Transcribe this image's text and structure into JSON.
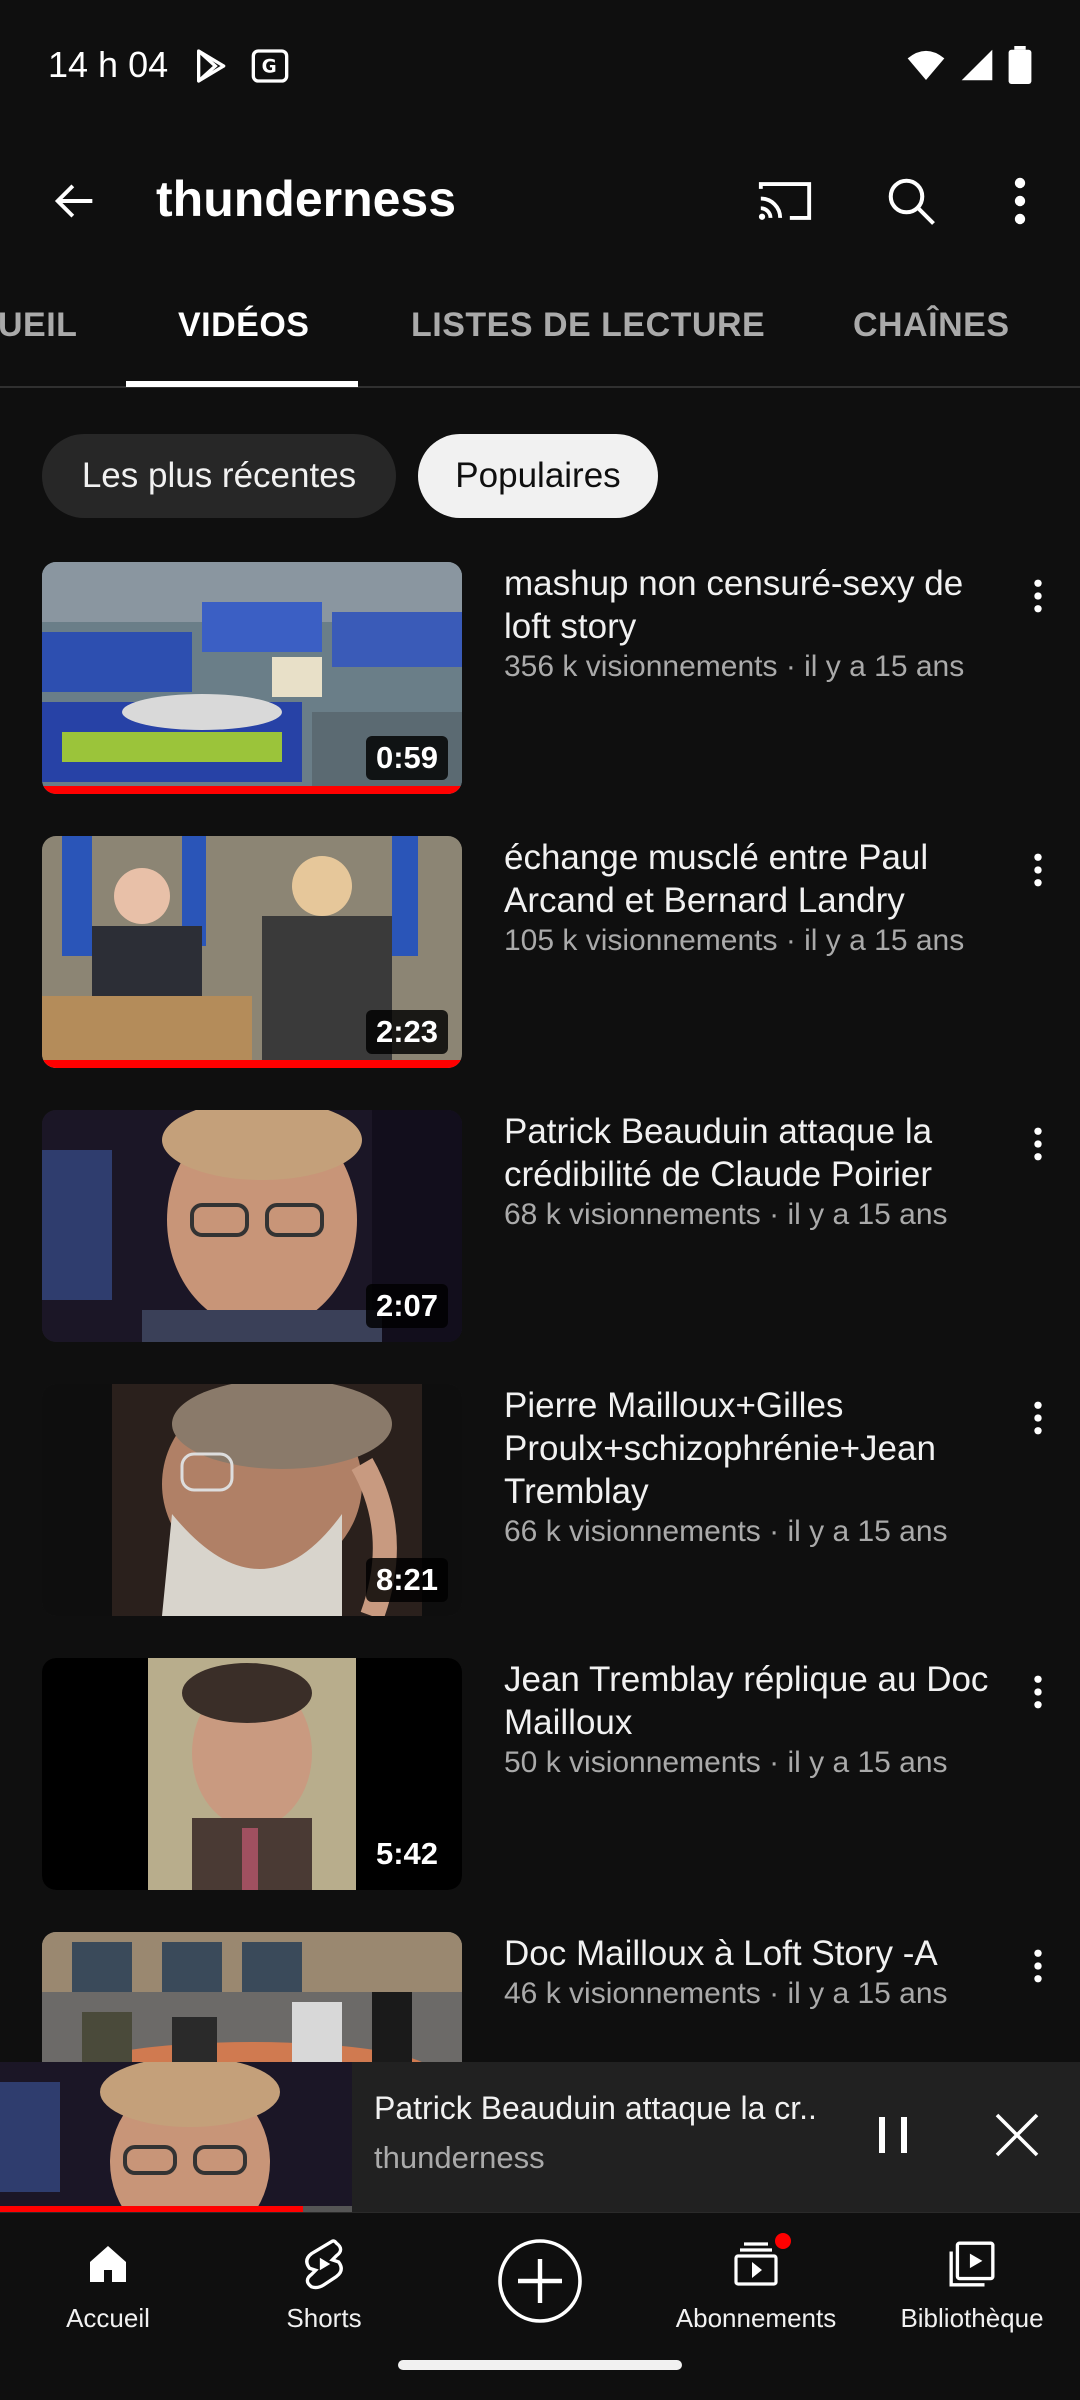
{
  "status_bar": {
    "time": "14 h 04"
  },
  "app_bar": {
    "title": "thunderness"
  },
  "tabs": [
    {
      "label": "ACCUEIL",
      "visible_text": "UEIL",
      "active": false
    },
    {
      "label": "VIDÉOS",
      "active": true
    },
    {
      "label": "LISTES DE LECTURE",
      "active": false
    },
    {
      "label": "CHAÎNES",
      "active": false
    }
  ],
  "filters": [
    {
      "label": "Les plus récentes",
      "selected": false
    },
    {
      "label": "Populaires",
      "selected": true
    }
  ],
  "videos": [
    {
      "title": "mashup non censuré-sexy de loft story",
      "meta": "356 k visionnements · il y a 15 ans",
      "duration": "0:59",
      "watched_fraction": 1.0
    },
    {
      "title": "échange musclé entre Paul Arcand et Bernard Landry",
      "meta": "105 k visionnements · il y a 15 ans",
      "duration": "2:23",
      "watched_fraction": 1.0
    },
    {
      "title": "Patrick Beauduin attaque la crédibilité de Claude Poirier",
      "meta": "68 k visionnements · il y a 15 ans",
      "duration": "2:07",
      "watched_fraction": 0
    },
    {
      "title": "Pierre Mailloux+Gilles Proulx+schizophrénie+Jean Tremblay",
      "meta": "66 k visionnements · il y a 15 ans",
      "duration": "8:21",
      "watched_fraction": 0
    },
    {
      "title": "Jean Tremblay réplique au Doc Mailloux",
      "meta": "50 k visionnements · il y a 15 ans",
      "duration": "5:42",
      "watched_fraction": 0
    },
    {
      "title": "Doc Mailloux à Loft Story -A",
      "meta": "46 k visionnements · il y a 15 ans",
      "duration": "",
      "watched_fraction": 0
    }
  ],
  "mini_player": {
    "title": "Patrick Beauduin attaque la cr..",
    "channel": "thunderness",
    "progress_fraction": 0.86
  },
  "bottom_nav": [
    {
      "label": "Accueil",
      "icon": "home-icon"
    },
    {
      "label": "Shorts",
      "icon": "shorts-icon"
    },
    {
      "label": "",
      "icon": "create-plus-icon"
    },
    {
      "label": "Abonnements",
      "icon": "subscriptions-icon",
      "badge": true
    },
    {
      "label": "Bibliothèque",
      "icon": "library-icon"
    }
  ],
  "colors": {
    "background": "#0f0f0f",
    "accent_red": "#ff0000",
    "chip_dark": "#272727",
    "chip_light": "#f1f1f1"
  }
}
